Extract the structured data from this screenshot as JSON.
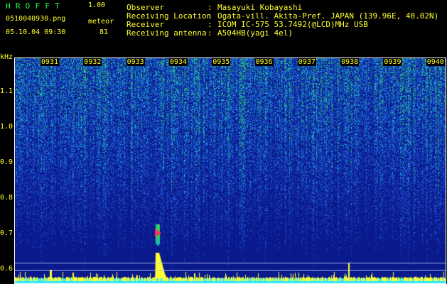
{
  "header": {
    "app_name": "HROFFT",
    "version": "1.00",
    "file_name": "0510040930.png",
    "mode": "meteor",
    "timestamp": "05.10.04 09:30",
    "meteor_count": "81"
  },
  "station_info": [
    {
      "key": "Observer",
      "value": "Masayuki Kobayashi"
    },
    {
      "key": "Receiving Location",
      "value": "Ogata-vill. Akita-Pref. JAPAN (139.96E, 40.02N)"
    },
    {
      "key": "Receiver",
      "value": "ICOM IC-575 53.7492(@LCD)MHz USB"
    },
    {
      "key": "Receiving antenna",
      "value": "A504HB(yagi 4el)"
    }
  ],
  "separator": ":",
  "spectrogram": {
    "unit_label": "kHz",
    "y_ticks": [
      {
        "label": "1.1",
        "value": 1.1
      },
      {
        "label": "1.0",
        "value": 1.0
      },
      {
        "label": "0.9",
        "value": 0.9
      },
      {
        "label": "0.8",
        "value": 0.8
      },
      {
        "label": "0.7",
        "value": 0.7
      },
      {
        "label": "0.6",
        "value": 0.6
      }
    ],
    "x_ticks": [
      "0931",
      "0932",
      "0933",
      "0934",
      "0935",
      "0936",
      "0937",
      "0938",
      "0939",
      "0940"
    ],
    "colors": {
      "background": "#0a1a8c",
      "noise_low": "#1e50d0",
      "noise_mid": "#18a8e0",
      "noise_high": "#30d060",
      "signal": "#ffff30",
      "peak": "#ff3060",
      "baseline": "#30e8ff"
    }
  }
}
